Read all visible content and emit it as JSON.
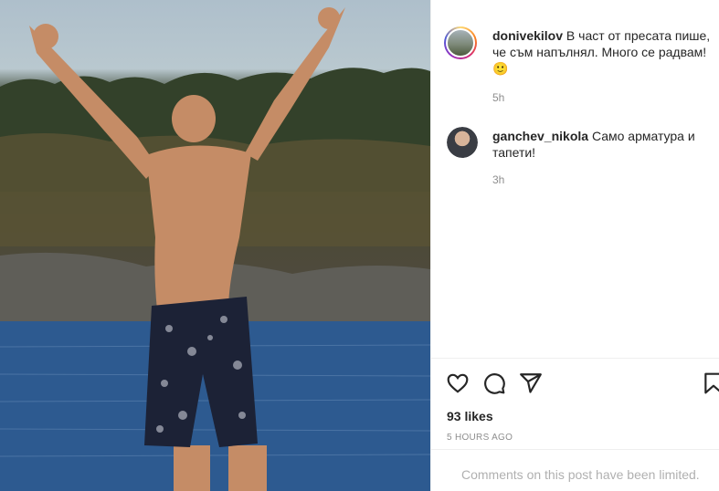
{
  "post": {
    "comments": [
      {
        "username": "donivekilov",
        "text": "В част от пресата пише, че съм напълнял. Много се радвам! 🙂",
        "time": "5h"
      },
      {
        "username": "ganchev_nikola",
        "text": "Само арматура и тапети!",
        "time": "3h"
      }
    ],
    "likes": "93 likes",
    "posted": "5 HOURS AGO",
    "limited_notice": "Comments on this post have been limited."
  },
  "icons": {
    "like": "heart-icon",
    "comment": "comment-bubble-icon",
    "share": "paper-plane-icon",
    "save": "bookmark-icon"
  }
}
